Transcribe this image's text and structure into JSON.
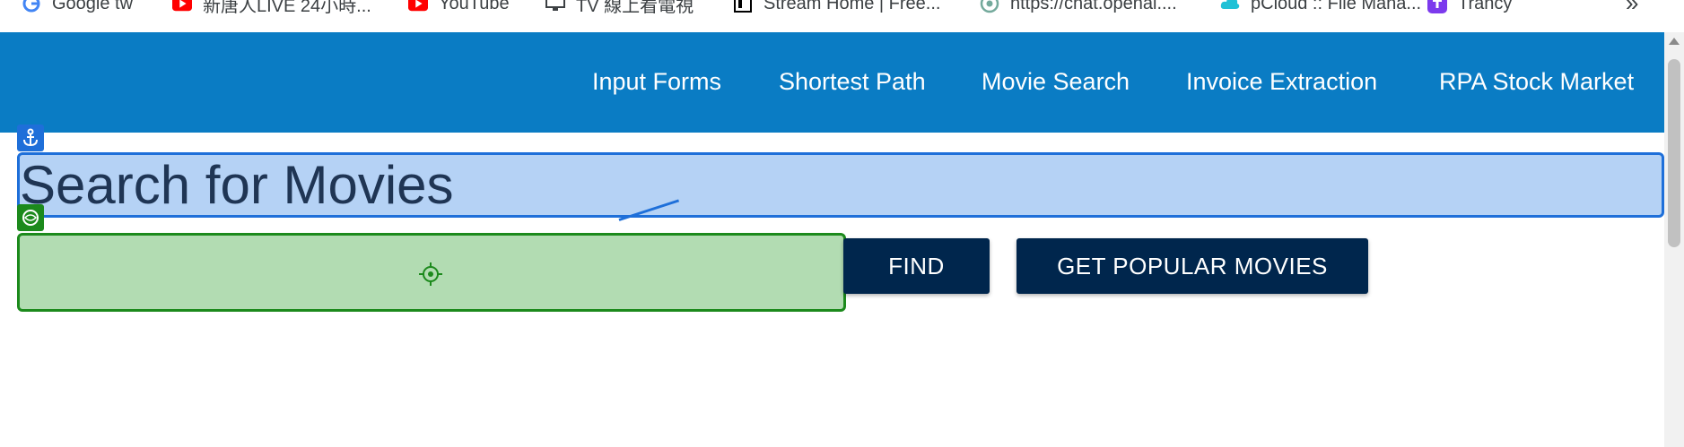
{
  "bookmarks": [
    {
      "label": "Google tw",
      "icon": "google-icon",
      "color": "#4285f4"
    },
    {
      "label": "新唐人LIVE 24小時...",
      "icon": "youtube-icon",
      "color": "#ff0000"
    },
    {
      "label": "YouTube",
      "icon": "youtube-icon",
      "color": "#ff0000"
    },
    {
      "label": "TV 線上看電視",
      "icon": "monitor-icon",
      "color": "#3c4043"
    },
    {
      "label": "Stream Home | Free...",
      "icon": "stream-icon",
      "color": "#000000"
    },
    {
      "label": "https://chat.openai....",
      "icon": "openai-icon",
      "color": "#74aa9c"
    },
    {
      "label": "pCloud :: File Mana...",
      "icon": "pcloud-icon",
      "color": "#20c1d6"
    },
    {
      "label": "Trancy",
      "icon": "trancy-icon",
      "color": "#7c3aed"
    }
  ],
  "bookmarks_more": "»",
  "nav": {
    "items": [
      "Input Forms",
      "Shortest Path",
      "Movie Search",
      "Invoice Extraction",
      "RPA Stock Market"
    ],
    "background": "#0a7cc4"
  },
  "main": {
    "title": "Search for Movies",
    "search": {
      "value": "",
      "placeholder": ""
    },
    "find_label": "FIND",
    "popular_label": "GET POPULAR MOVIES",
    "button_color": "#00264d"
  },
  "overlays": {
    "heading_highlight": "#b5d2f5",
    "input_highlight": "#b2dcb2"
  }
}
